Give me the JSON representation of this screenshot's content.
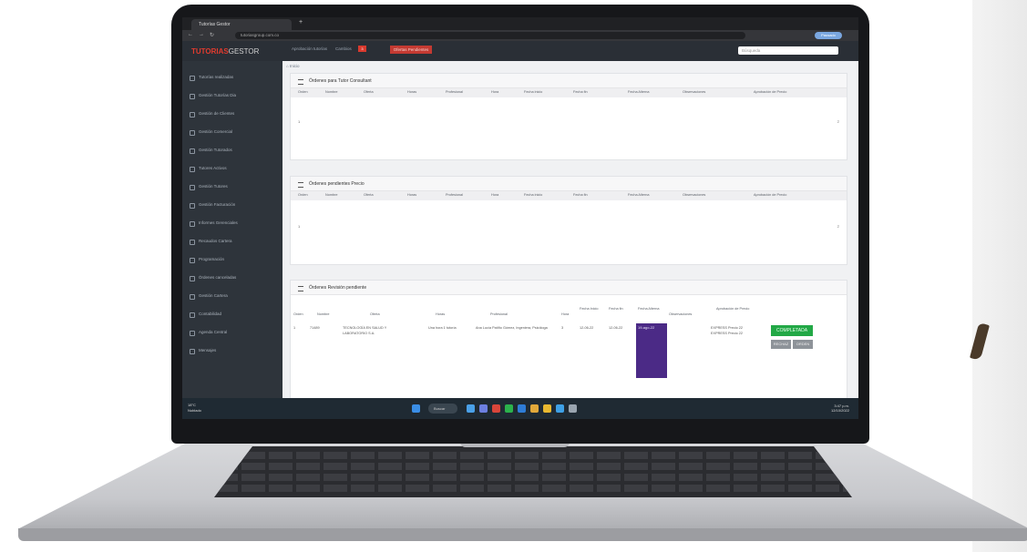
{
  "browser": {
    "tab_title": "Tutorías Gestor",
    "url": "tutoriasgroup.com.co",
    "profile_label": "Pausado"
  },
  "header": {
    "logo_brand": "TUTORIAS",
    "logo_suffix": "GESTOR",
    "menu_left": "Aprobación tutorías",
    "menu_mid": "Cambios",
    "badge_count": "3",
    "red_button": "Ofertas Pendientes",
    "search_placeholder": "Búsqueda"
  },
  "sidebar": {
    "items": [
      {
        "label": "Tutorías realizadas"
      },
      {
        "label": "Gestión Tutorías Dia"
      },
      {
        "label": "Gestión de Clientes"
      },
      {
        "label": "Gestión Comercial"
      },
      {
        "label": "Gestión Tutorados"
      },
      {
        "label": "Tutores Activos"
      },
      {
        "label": "Gestión Tutores"
      },
      {
        "label": "Gestión Facturación"
      },
      {
        "label": "Informes Gerenciales"
      },
      {
        "label": "Recaudos Cartera"
      },
      {
        "label": "Programación"
      },
      {
        "label": "Órdenes canceladas"
      },
      {
        "label": "Gestión Cartera"
      },
      {
        "label": "Contabilidad"
      },
      {
        "label": "Agenda Central"
      },
      {
        "label": "Mensajes"
      }
    ]
  },
  "main": {
    "breadcrumb": "⌂ Inicio",
    "panel1": {
      "title": "Órdenes para Tutor Consultant",
      "headers": [
        "Orden",
        "Nombre",
        "Oferta",
        "Horas",
        "Profesional",
        "Hora",
        "Fecha inicio",
        "Fecha fin",
        "Fecha Alterna",
        "Observaciones",
        "Aprobación de Precio"
      ],
      "row_index": "1",
      "row_meta": "2"
    },
    "panel2": {
      "title": "Órdenes pendientes Precio",
      "headers": [
        "Orden",
        "Nombre",
        "Oferta",
        "Horas",
        "Profesional",
        "Hora",
        "Fecha inicio",
        "Fecha fin",
        "Fecha Alterna",
        "Observaciones",
        "Aprobación de Precio"
      ],
      "row_index": "1",
      "row_meta": "2"
    },
    "panel3": {
      "title": "Órdenes Revisión pendiente",
      "headers": [
        "Orden",
        "Nombre",
        "Oferta",
        "Horas",
        "Profesional",
        "Hora",
        "Fecha Inicio",
        "Fecha fin",
        "Fecha Alterna",
        "Observaciones",
        "Aprobación de Precio"
      ],
      "row": {
        "orden": "1",
        "nombre": "71489",
        "oferta": "TECNOLOGÍA EN SALUD Y LABORATORIO S.A.",
        "horas": "Una hora 1 tutoría",
        "profesional": "Ana Lucía Patiño Gómez, Ingeniera, Psicóloga",
        "hora": "3",
        "fecha_inicio": "12-06-22",
        "fecha_fin": "12-06-22",
        "fecha_alterna": "19-ago-22",
        "aprobacion": "EXPRESS Precio 22 EXPRESS Precio 22",
        "completed_label": "COMPLETADA",
        "btn_a": "RECHAZ",
        "btn_b": "ORDEN"
      }
    }
  },
  "taskbar": {
    "weather_temp": "18°C",
    "weather_desc": "Nublado",
    "search_label": "Buscar",
    "time": "3:47 p.m.",
    "date": "12/10/2022"
  },
  "colors": {
    "sidebar_bg": "#2e343b",
    "header_bg": "#2a2f36",
    "accent_red": "#c43a32",
    "green": "#22a846",
    "purple": "#4b2a86"
  }
}
